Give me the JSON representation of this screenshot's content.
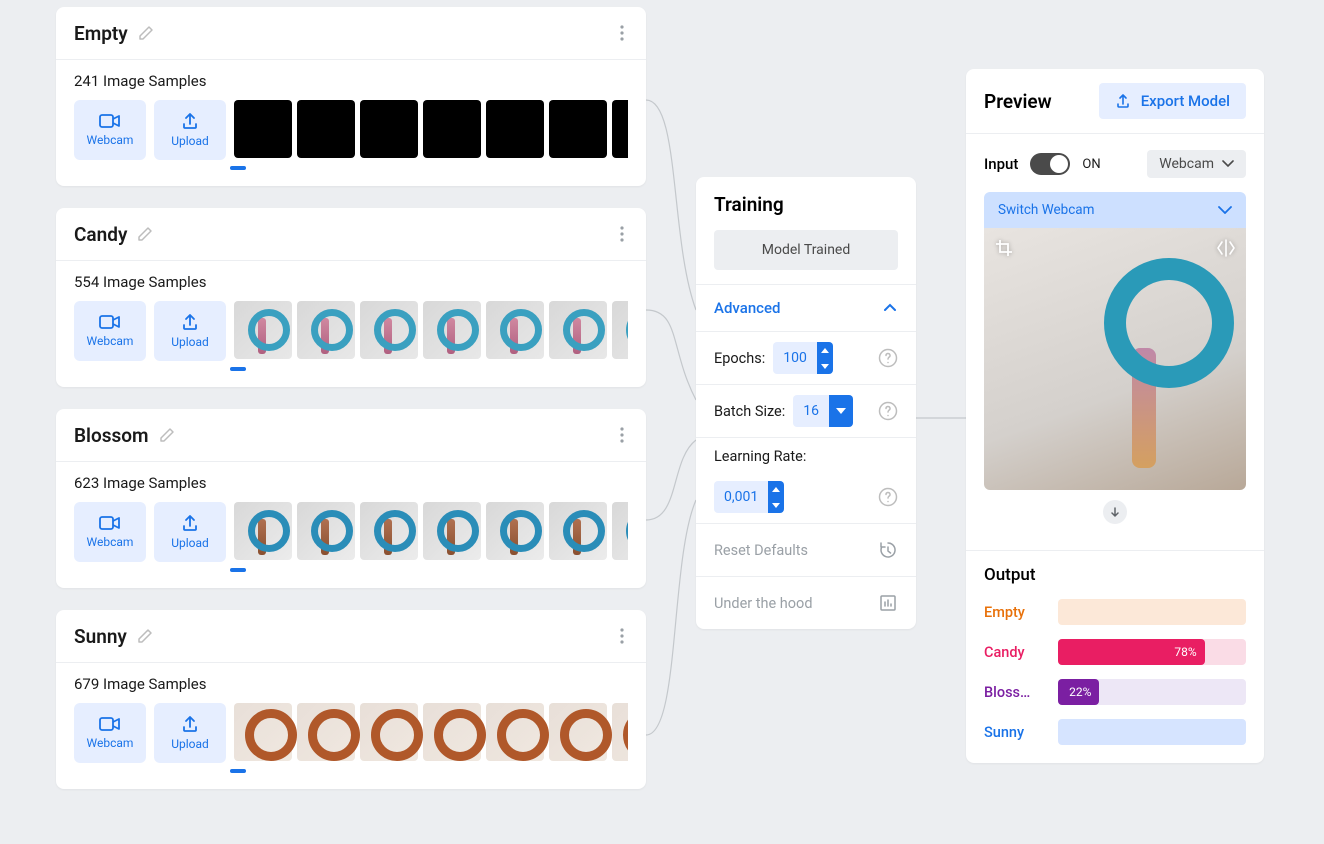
{
  "classes": [
    {
      "name": "Empty",
      "samples": "241 Image Samples",
      "thumb_style": "black"
    },
    {
      "name": "Candy",
      "samples": "554 Image Samples",
      "thumb_style": "candy"
    },
    {
      "name": "Blossom",
      "samples": "623 Image Samples",
      "thumb_style": "blossom"
    },
    {
      "name": "Sunny",
      "samples": "679 Image Samples",
      "thumb_style": "sunny"
    }
  ],
  "input_buttons": {
    "webcam": "Webcam",
    "upload": "Upload"
  },
  "training": {
    "title": "Training",
    "button_label": "Model Trained",
    "advanced_label": "Advanced",
    "epochs_label": "Epochs:",
    "epochs_value": "100",
    "batch_label": "Batch Size:",
    "batch_value": "16",
    "lr_label": "Learning Rate:",
    "lr_value": "0,001",
    "reset_label": "Reset Defaults",
    "hood_label": "Under the hood"
  },
  "preview": {
    "title": "Preview",
    "export_label": "Export Model",
    "input_label": "Input",
    "toggle_state": "ON",
    "source_label": "Webcam",
    "switch_label": "Switch Webcam",
    "output_label": "Output",
    "predictions": [
      {
        "label": "Empty",
        "percent": 0,
        "text": "",
        "class": "c-empty"
      },
      {
        "label": "Candy",
        "percent": 78,
        "text": "78%",
        "class": "c-candy"
      },
      {
        "label": "Bloss…",
        "percent": 22,
        "text": "22%",
        "class": "c-blossom"
      },
      {
        "label": "Sunny",
        "percent": 0,
        "text": "",
        "class": "c-sunny"
      }
    ]
  }
}
